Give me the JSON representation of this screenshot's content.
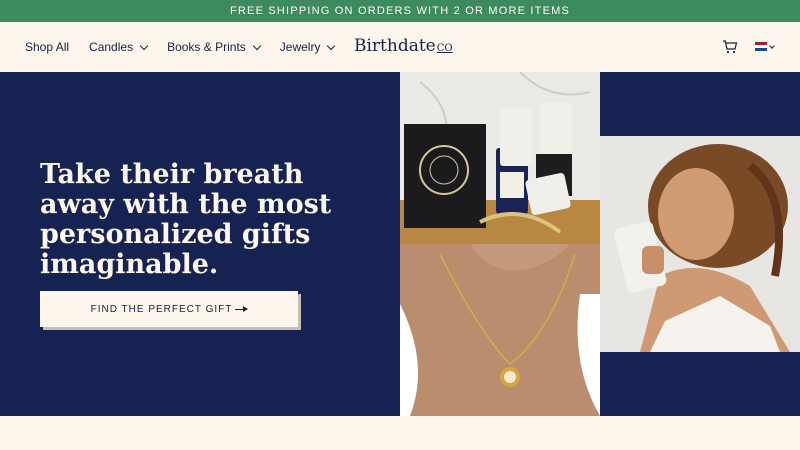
{
  "announcement": "FREE SHIPPING ON ORDERS WITH 2 OR MORE ITEMS",
  "nav": {
    "items": [
      {
        "label": "Shop All",
        "dropdown": false
      },
      {
        "label": "Candles",
        "dropdown": true
      },
      {
        "label": "Books & Prints",
        "dropdown": true
      },
      {
        "label": "Jewelry",
        "dropdown": true
      }
    ]
  },
  "brand": {
    "name": "Birthdate",
    "suffix": "CO"
  },
  "icons": {
    "cart": "cart-icon",
    "flag": "netherlands-flag-icon"
  },
  "hero": {
    "headline": "Take their breath away with the most personalized gifts imaginable.",
    "cta_label": "FIND THE PERFECT GIFT"
  },
  "colors": {
    "announce_bg": "#3e8a5f",
    "navy": "#152252",
    "cream": "#fdf6ec"
  }
}
